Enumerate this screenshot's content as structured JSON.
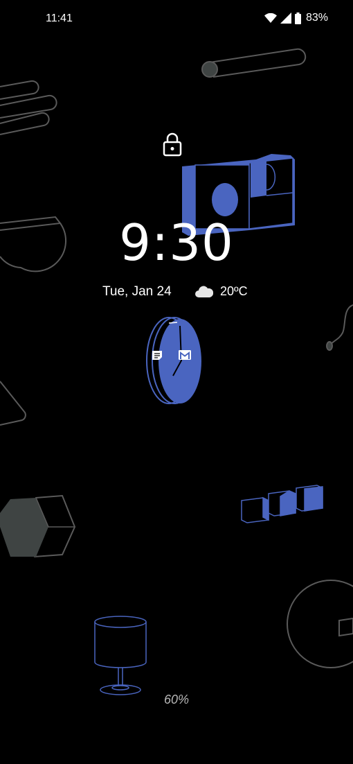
{
  "status_bar": {
    "time": "11:41",
    "battery": "83%",
    "icons": [
      "wifi-icon",
      "cellular-signal-icon",
      "battery-icon"
    ]
  },
  "lock_screen": {
    "clock": "9:30",
    "date": "Tue, Jan 24",
    "weather": {
      "icon": "cloud-icon",
      "temperature": "20ºC"
    },
    "notification_icons": [
      "notes-icon",
      "gmail-icon"
    ],
    "charging_level": "60%"
  },
  "colors": {
    "background": "#000000",
    "accent_blue": "#4a65c0",
    "outline_gray": "#5a5a5a",
    "hexagon_fill": "#3f4443",
    "text": "#ffffff",
    "muted_text": "#b8b8b8"
  }
}
